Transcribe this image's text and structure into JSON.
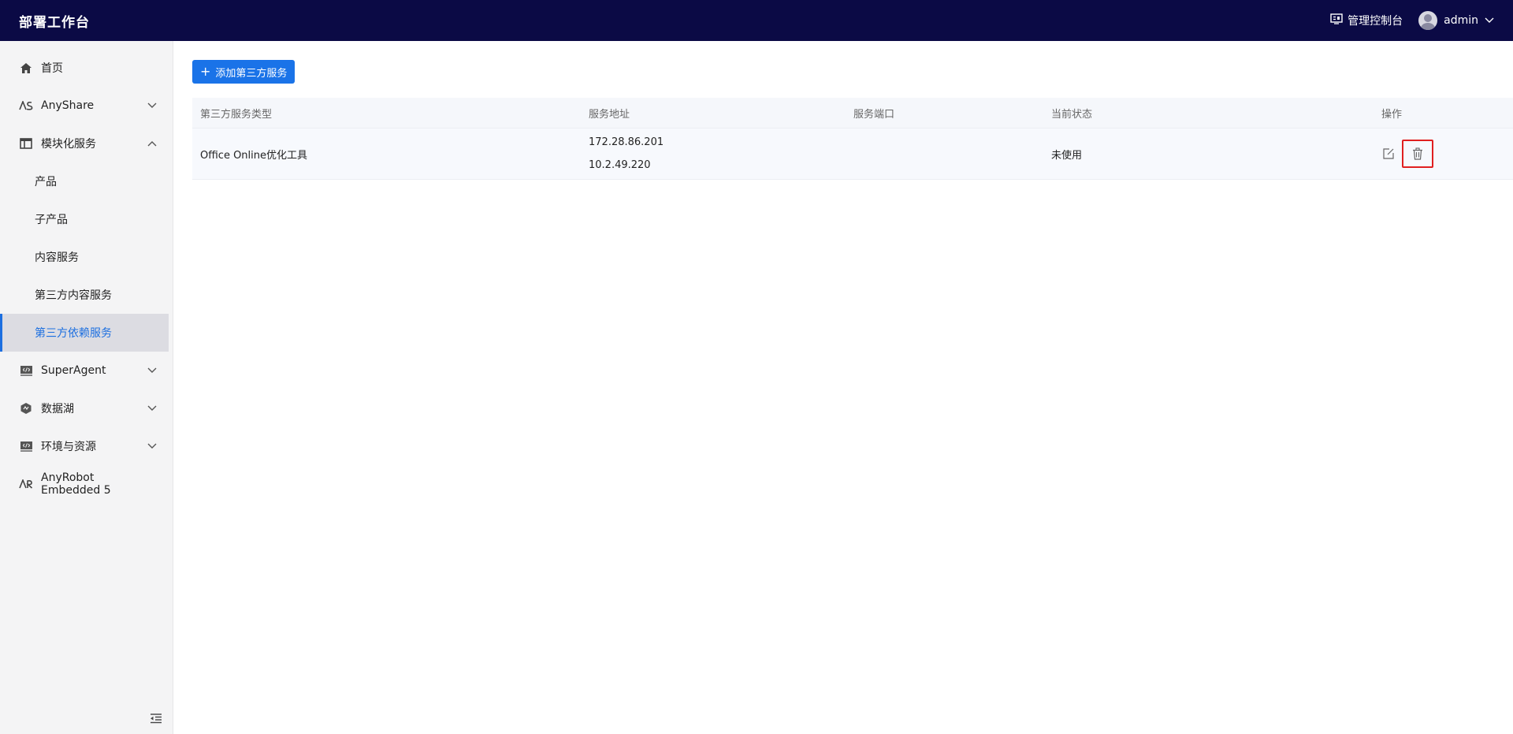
{
  "header": {
    "title": "部署工作台",
    "console_label": "管理控制台",
    "username": "admin"
  },
  "sidebar": {
    "items": [
      {
        "label": "首页",
        "icon": "home-icon"
      },
      {
        "label": "AnyShare",
        "icon": "anyshare-logo-icon",
        "expandable": true
      },
      {
        "label": "模块化服务",
        "icon": "layout-icon",
        "expandable": true,
        "expanded": true
      },
      {
        "label": "SuperAgent",
        "icon": "code-window-icon",
        "expandable": true
      },
      {
        "label": "数据湖",
        "icon": "hexagon-icon",
        "expandable": true
      },
      {
        "label": "环境与资源",
        "icon": "code-window-icon",
        "expandable": true
      },
      {
        "label": "AnyRobot Embedded 5",
        "icon": "anyrobot-logo-icon"
      }
    ],
    "sub_items": [
      {
        "label": "产品"
      },
      {
        "label": "子产品"
      },
      {
        "label": "内容服务"
      },
      {
        "label": "第三方内容服务"
      },
      {
        "label": "第三方依赖服务",
        "active": true
      }
    ]
  },
  "main": {
    "add_button_label": "添加第三方服务",
    "table": {
      "columns": [
        "第三方服务类型",
        "服务地址",
        "服务端口",
        "当前状态",
        "操作"
      ],
      "rows": [
        {
          "type": "Office Online优化工具",
          "addresses": [
            "172.28.86.201",
            "10.2.49.220"
          ],
          "port": "",
          "status": "未使用"
        }
      ]
    }
  },
  "colors": {
    "header_bg": "#0b0a45",
    "primary": "#1a73e8",
    "highlight_border": "#e02020",
    "sidebar_bg": "#f4f4f5"
  }
}
